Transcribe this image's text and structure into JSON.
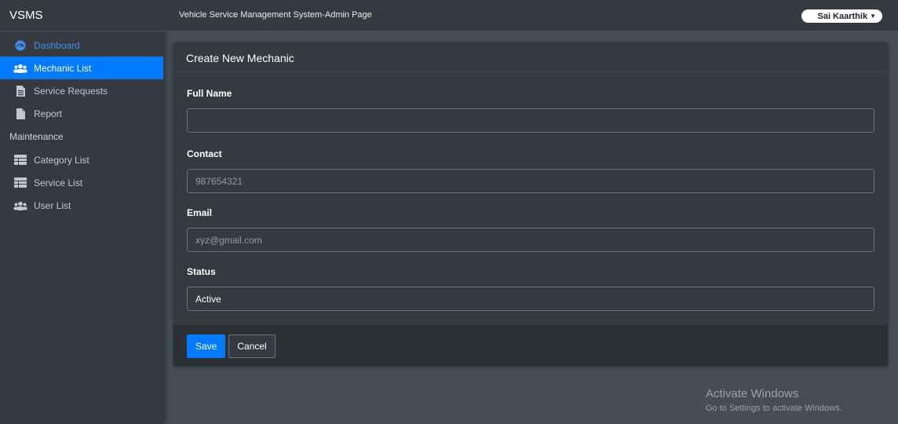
{
  "app": {
    "brand": "VSMS",
    "page_title": "Vehicle Service Management System-Admin Page"
  },
  "user": {
    "name": "Sai Kaarthik"
  },
  "sidebar": {
    "items": [
      {
        "label": "Dashboard",
        "icon": "dashboard-icon"
      },
      {
        "label": "Mechanic List",
        "icon": "users-icon",
        "active": true
      },
      {
        "label": "Service Requests",
        "icon": "file-icon"
      },
      {
        "label": "Report",
        "icon": "document-icon"
      }
    ],
    "section_header": "Maintenance",
    "maintenance_items": [
      {
        "label": "Category List",
        "icon": "table-icon"
      },
      {
        "label": "Service List",
        "icon": "table-icon"
      },
      {
        "label": "User List",
        "icon": "users-icon"
      }
    ]
  },
  "form": {
    "title": "Create New Mechanic",
    "fields": {
      "full_name": {
        "label": "Full Name",
        "value": "",
        "placeholder": ""
      },
      "contact": {
        "label": "Contact",
        "value": "",
        "placeholder": "987654321"
      },
      "email": {
        "label": "Email",
        "value": "",
        "placeholder": "xyz@gmail.com"
      },
      "status": {
        "label": "Status",
        "value": "Active"
      }
    },
    "buttons": {
      "save": "Save",
      "cancel": "Cancel"
    }
  },
  "watermark": {
    "line1": "Activate Windows",
    "line2": "Go to Settings to activate Windows."
  },
  "colors": {
    "accent": "#007bff",
    "sidebar_bg": "#343a40",
    "content_bg": "#454d55"
  }
}
